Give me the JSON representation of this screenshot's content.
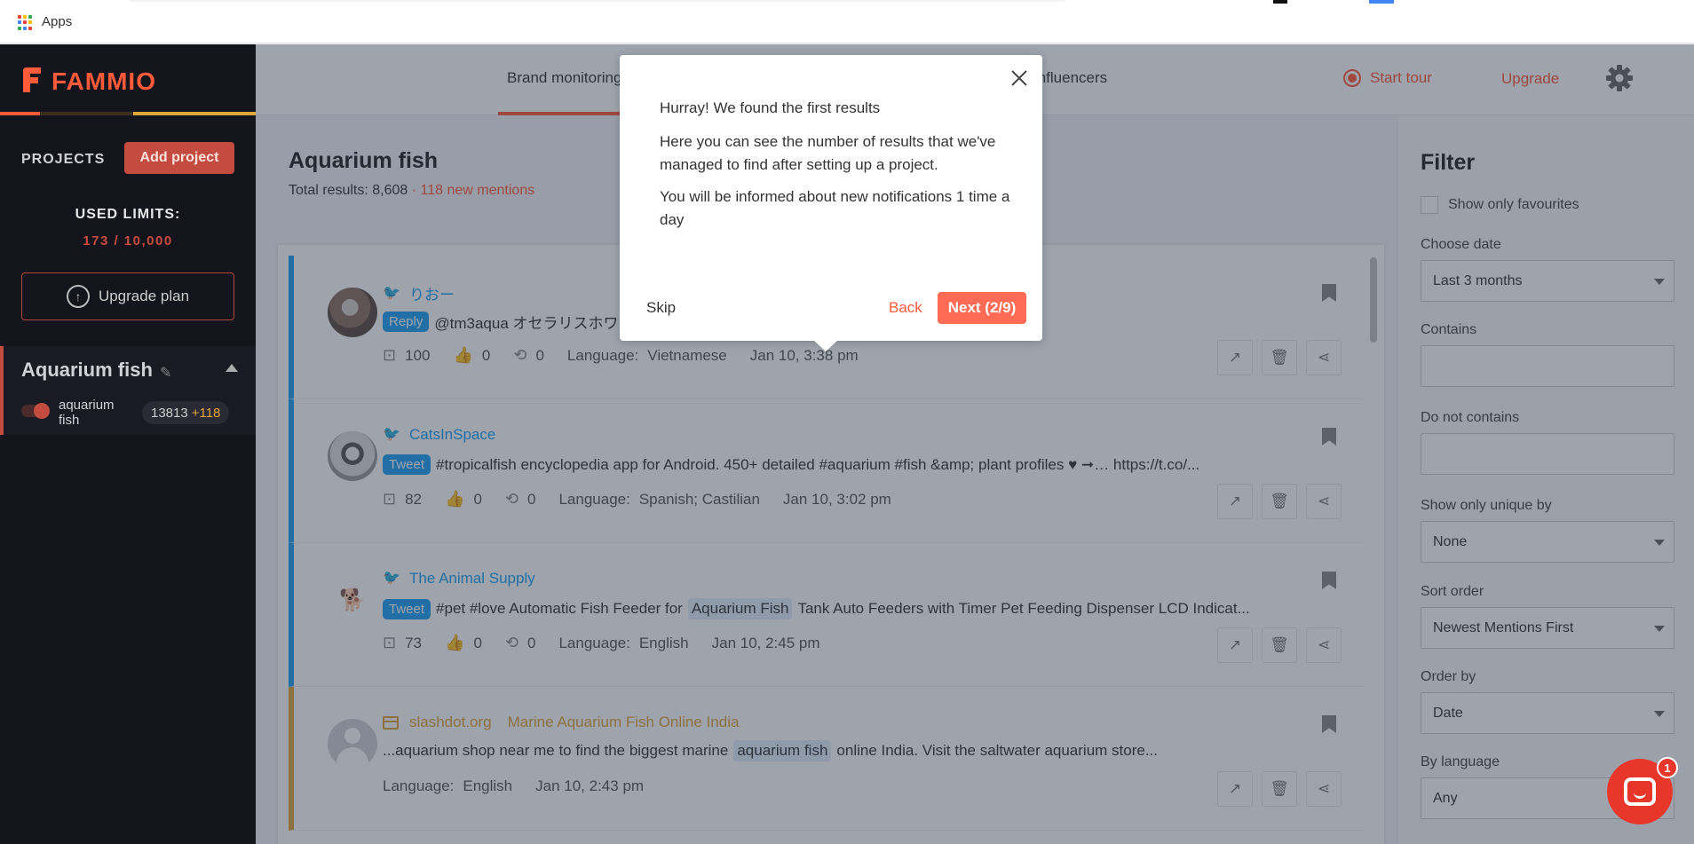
{
  "browser": {
    "apps_label": "Apps"
  },
  "sidebar": {
    "logo_text": "FAMMIO",
    "projects_label": "PROJECTS",
    "add_project_label": "Add project",
    "limits_title": "USED LIMITS:",
    "limits_value": "173 / 10,000",
    "upgrade_plan_label": "Upgrade plan",
    "project": {
      "name": "Aquarium fish",
      "keyword": "aquarium fish",
      "count": "13813",
      "new_count": "+118"
    }
  },
  "topnav": {
    "tab_brand": "Brand monitoring",
    "tab_influencers": "Influencers",
    "start_tour": "Start tour",
    "upgrade": "Upgrade"
  },
  "main": {
    "title": "Aquarium fish",
    "total_label": "Total results:",
    "total_value": "8,608",
    "new_mentions": "· 118 new mentions",
    "mentions": [
      {
        "author": "りおー",
        "kind": "Reply",
        "text": "@tm3aqua オセラリスホワ",
        "reach": "100",
        "likes": "0",
        "retweets": "0",
        "language_label": "Language:",
        "language": "Vietnamese",
        "date": "Jan 10, 3:38 pm"
      },
      {
        "author": "CatsInSpace",
        "kind": "Tweet",
        "text": "#tropicalfish encyclopedia app for Android. 450+ detailed #aquarium #fish &amp; plant profiles ♥ ➞… https://t.co/...",
        "reach": "82",
        "likes": "0",
        "retweets": "0",
        "language_label": "Language:",
        "language": "Spanish; Castilian",
        "date": "Jan 10, 3:02 pm"
      },
      {
        "author": "The Animal Supply",
        "kind": "Tweet",
        "text_before": "#pet #love Automatic Fish Feeder for",
        "highlight": "Aquarium Fish",
        "text_after": "Tank Auto Feeders with Timer Pet Feeding Dispenser LCD Indicat...",
        "reach": "73",
        "likes": "0",
        "retweets": "0",
        "language_label": "Language:",
        "language": "English",
        "date": "Jan 10, 2:45 pm"
      },
      {
        "source": "slashdot.org",
        "title": "Marine Aquarium Fish Online India",
        "text_before": "...aquarium shop near me to find the biggest marine",
        "highlight": "aquarium fish",
        "text_after": "online India. Visit the saltwater aquarium store...",
        "language_label": "Language:",
        "language": "English",
        "date": "Jan 10, 2:43 pm"
      }
    ]
  },
  "filter": {
    "title": "Filter",
    "favourites_label": "Show only favourites",
    "date_label": "Choose date",
    "date_value": "Last 3 months",
    "contains_label": "Contains",
    "contains_value": "",
    "not_contains_label": "Do not contains",
    "not_contains_value": "",
    "unique_label": "Show only unique by",
    "unique_value": "None",
    "sort_label": "Sort order",
    "sort_value": "Newest Mentions First",
    "order_label": "Order by",
    "order_value": "Date",
    "language_label": "By language",
    "language_value": "Any"
  },
  "tour": {
    "title": "Hurray! We found the first results",
    "body_1": "Here you can see the number of results that we've managed to find after setting up a project.",
    "body_2": "You will be informed about new notifications 1 time a day",
    "skip": "Skip",
    "back": "Back",
    "next": "Next (2/9)"
  },
  "chat": {
    "badge": "1"
  },
  "colors": {
    "brand": "#ff5a3a",
    "twitter": "#1da1f2",
    "web": "#e0a53a",
    "sidebar_bg": "#14141c"
  }
}
